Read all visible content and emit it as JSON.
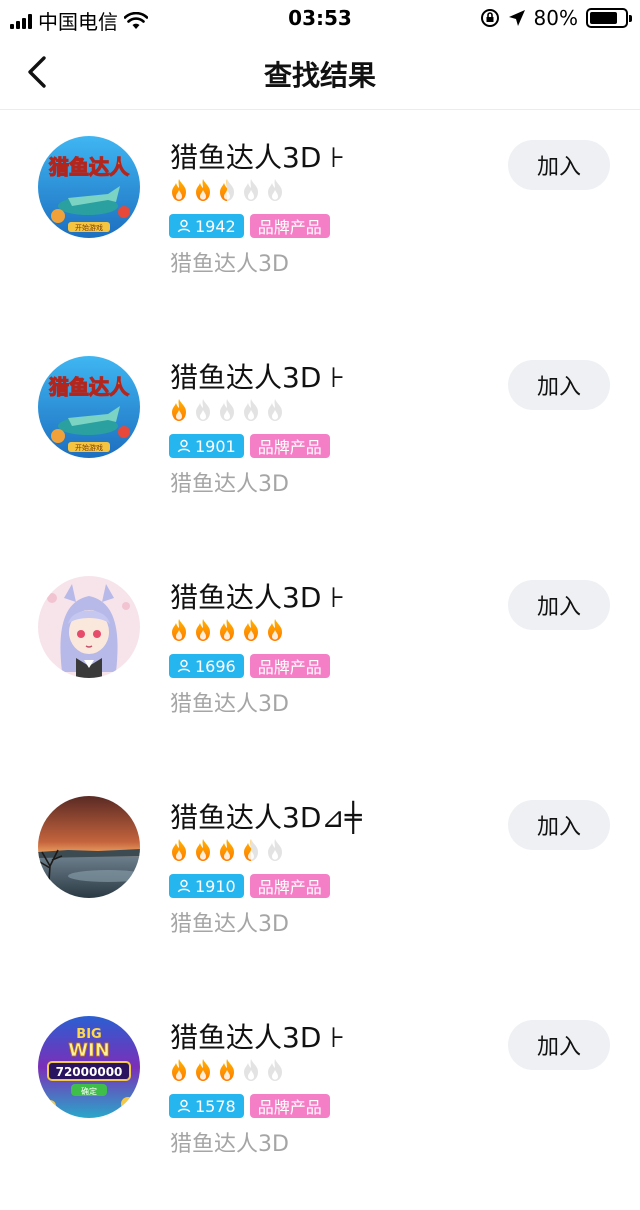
{
  "status_bar": {
    "carrier": "中国电信",
    "time": "03:53",
    "battery": "80%",
    "battery_level": 0.8
  },
  "nav": {
    "title": "查找结果",
    "back_icon": "chevron-left-icon"
  },
  "results": [
    {
      "name": "猎鱼达人3D ⊦",
      "rating": 2.5,
      "members": "1942",
      "tag": "品牌产品",
      "subtitle": "猎鱼达人3D",
      "join_label": "加入",
      "avatar": "fish-game"
    },
    {
      "name": "猎鱼达人3D ⊦",
      "rating": 1,
      "members": "1901",
      "tag": "品牌产品",
      "subtitle": "猎鱼达人3D",
      "join_label": "加入",
      "avatar": "fish-game"
    },
    {
      "name": "猎鱼达人3D ⊦",
      "rating": 5,
      "members": "1696",
      "tag": "品牌产品",
      "subtitle": "猎鱼达人3D",
      "join_label": "加入",
      "avatar": "anime-girl"
    },
    {
      "name": "猎鱼达人3D⊿╪",
      "rating": 3.5,
      "members": "1910",
      "tag": "品牌产品",
      "subtitle": "猎鱼达人3D",
      "join_label": "加入",
      "avatar": "sunset"
    },
    {
      "name": "猎鱼达人3D ⊦",
      "rating": 3,
      "members": "1578",
      "tag": "品牌产品",
      "subtitle": "猎鱼达人3D",
      "join_label": "加入",
      "avatar": "slot-win"
    }
  ],
  "avatar_texts": {
    "fish_title": "猎鱼达人",
    "fish_button": "开始游戏",
    "slot_big": "BIG",
    "slot_win": "WIN",
    "slot_amount": "72000000",
    "slot_button": "确定"
  },
  "colors": {
    "flame_on": "#ff9a00",
    "flame_off": "#e3e3e3",
    "count_tag": "#26b6ef",
    "brand_tag": "#f57fc7"
  }
}
